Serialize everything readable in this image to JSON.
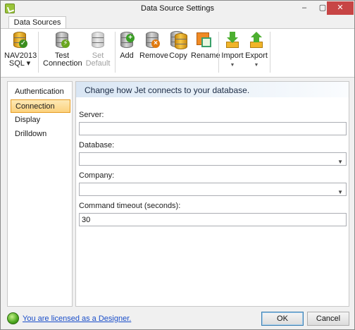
{
  "window": {
    "title": "Data Source Settings"
  },
  "ribbon": {
    "tab_label": "Data Sources",
    "buttons": [
      {
        "label_line1": "NAV2013",
        "label_line2": "SQL ▾",
        "icon": "database-check-icon",
        "disabled": false
      },
      {
        "label_line1": "Test",
        "label_line2": "Connection",
        "icon": "database-test-icon",
        "disabled": false
      },
      {
        "label_line1": "Set",
        "label_line2": "Default",
        "icon": "database-default-icon",
        "disabled": true
      },
      {
        "label_line1": "Add",
        "label_line2": "",
        "icon": "database-add-icon",
        "disabled": false
      },
      {
        "label_line1": "Remove",
        "label_line2": "",
        "icon": "database-remove-icon",
        "disabled": false
      },
      {
        "label_line1": "Copy",
        "label_line2": "",
        "icon": "database-copy-icon",
        "disabled": false
      },
      {
        "label_line1": "Rename",
        "label_line2": "",
        "icon": "rename-icon",
        "disabled": false
      },
      {
        "label_line1": "Import",
        "label_line2": "",
        "icon": "import-icon",
        "disabled": false
      },
      {
        "label_line1": "Export",
        "label_line2": "",
        "icon": "export-icon",
        "disabled": false
      }
    ]
  },
  "nav": {
    "items": [
      "Authentication",
      "Connection",
      "Display",
      "Drilldown"
    ],
    "active": "Connection"
  },
  "panel": {
    "header": "Change how Jet connects to your database.",
    "fields": [
      {
        "label": "Server:",
        "value": "",
        "type": "text"
      },
      {
        "label": "Database:",
        "value": "",
        "type": "dropdown"
      },
      {
        "label": "Company:",
        "value": "",
        "type": "dropdown"
      },
      {
        "label": "Command timeout (seconds):",
        "value": "30",
        "type": "text"
      }
    ]
  },
  "status": {
    "license_text": "You are licensed as a Designer.",
    "ok_label": "OK",
    "cancel_label": "Cancel"
  },
  "colors": {
    "accent_orange": "#e59a1f",
    "led_green": "#4aa61e",
    "link_blue": "#1a4ec9",
    "header_blue": "#d9e6f4"
  }
}
